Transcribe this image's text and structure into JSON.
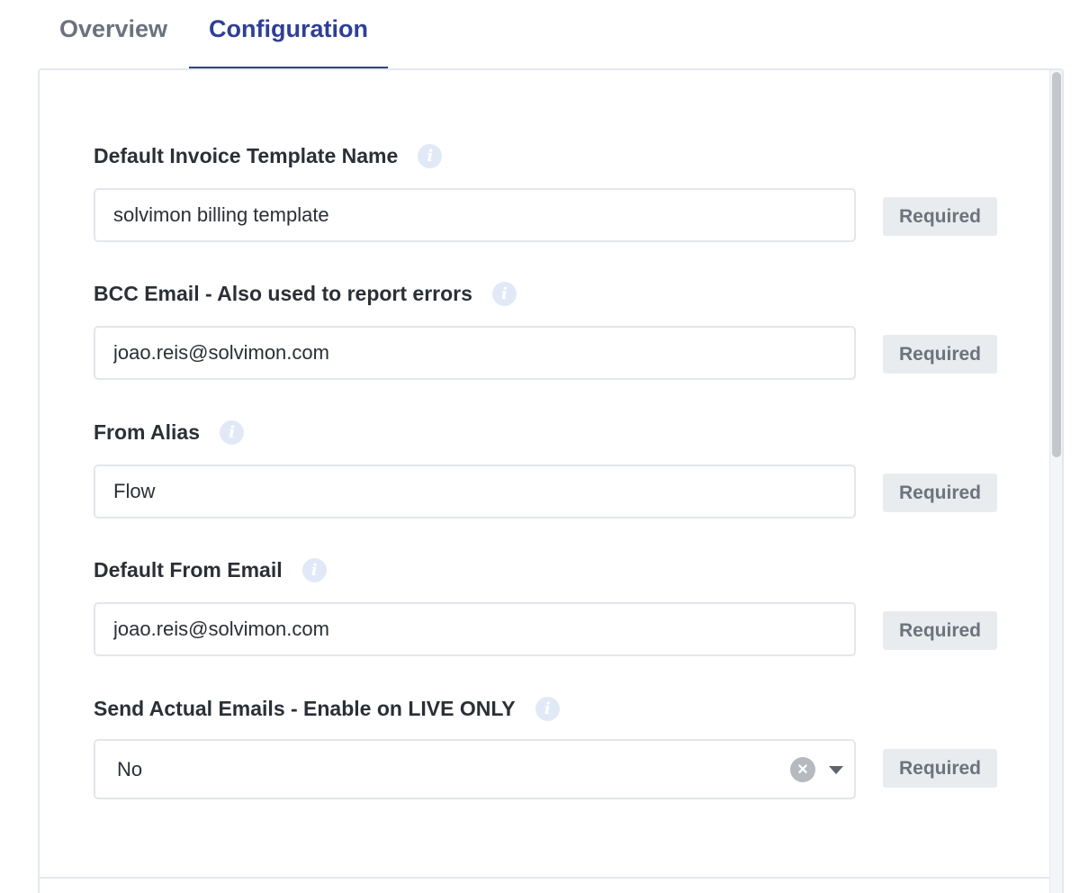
{
  "tabs": [
    {
      "label": "Overview",
      "active": false
    },
    {
      "label": "Configuration",
      "active": true
    }
  ],
  "colors": {
    "accent": "#2e3f96",
    "info_icon_bg": "#e2e9f6",
    "badge_bg": "#e9ecef"
  },
  "fields": [
    {
      "label": "Default Invoice Template Name",
      "value": "solvimon billing template",
      "badge": "Required",
      "icon": "info-icon"
    },
    {
      "label": "BCC Email - Also used to report errors",
      "value": "joao.reis@solvimon.com",
      "badge": "Required",
      "icon": "info-icon"
    },
    {
      "label": "From Alias",
      "value": "Flow",
      "badge": "Required",
      "icon": "info-icon"
    },
    {
      "label": "Default From Email",
      "value": "joao.reis@solvimon.com",
      "badge": "Required",
      "icon": "info-icon"
    },
    {
      "label": "Send Actual Emails - Enable on LIVE ONLY",
      "value": "No",
      "badge": "Required",
      "icon": "info-icon",
      "control": "select"
    }
  ]
}
